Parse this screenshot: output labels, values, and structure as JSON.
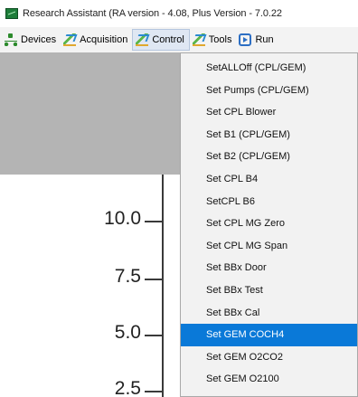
{
  "window": {
    "title": "Research Assistant (RA version - 4.08, Plus Version - 7.0.22"
  },
  "menubar": {
    "items": [
      {
        "label": "Devices",
        "icon": "devices-icon"
      },
      {
        "label": "Acquisition",
        "icon": "acquisition-icon"
      },
      {
        "label": "Control",
        "icon": "control-icon",
        "active": true
      },
      {
        "label": "Tools",
        "icon": "tools-icon"
      },
      {
        "label": "Run",
        "icon": "run-icon"
      }
    ]
  },
  "control_menu": {
    "items": [
      "SetALLOff (CPL/GEM)",
      "Set Pumps  (CPL/GEM)",
      "Set CPL Blower",
      "Set B1  (CPL/GEM)",
      "Set B2  (CPL/GEM)",
      "Set CPL  B4",
      "SetCPL B6",
      "Set CPL MG Zero",
      "Set CPL MG Span",
      "Set BBx Door",
      "Set BBx Test",
      "Set BBx Cal",
      "Set GEM  COCH4",
      "Set GEM  O2CO2",
      "Set GEM  O2100"
    ],
    "selected": "Set GEM  COCH4"
  },
  "plot": {
    "y_ticks": [
      "10.0",
      "7.5",
      "5.0",
      "2.5"
    ]
  },
  "colors": {
    "selection": "#0a79d8",
    "gray_area": "#b4b4b4",
    "menubar": "#f3f3f3"
  }
}
